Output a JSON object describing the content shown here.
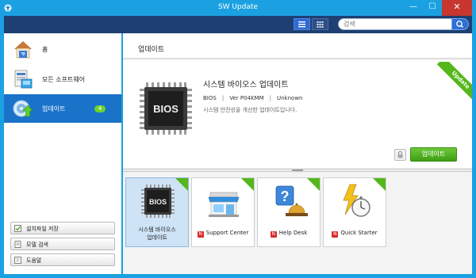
{
  "window": {
    "title": "SW Update",
    "close": "✕",
    "maximize": "☐",
    "minimize": "—"
  },
  "toolbar": {
    "search_placeholder": "검색"
  },
  "sidebar": {
    "items": [
      {
        "label": "홈",
        "icon": "house-icon"
      },
      {
        "label": "모든 소프트웨어",
        "icon": "software-icon"
      },
      {
        "label": "업데이트",
        "icon": "update-icon",
        "badge": "4",
        "selected": true
      }
    ],
    "buttons": [
      {
        "label": "설치파일 저장",
        "icon": "save-icon"
      },
      {
        "label": "모델 검색",
        "icon": "document-icon"
      },
      {
        "label": "도움말",
        "icon": "help-icon"
      }
    ]
  },
  "main": {
    "title": "업데이트",
    "detail": {
      "title": "시스템 바이오스 업데이트",
      "category": "BIOS",
      "version": "Ver P04KMM",
      "size": "Unknown",
      "description": "시스템 안전성을 개선한 업데이트입니다.",
      "ribbon": "Update",
      "update_button": "업데이트",
      "chip_text": "BIOS"
    },
    "tiles": [
      {
        "label_line1": "시스템 바이오스",
        "label_line2": "업데이트",
        "icon": "bios-chip-icon",
        "selected": true,
        "chip_text": "BIOS"
      },
      {
        "label": "Support Center",
        "icon": "store-icon",
        "n_badge": "N"
      },
      {
        "label": "Help Desk",
        "icon": "help-desk-icon",
        "n_badge": "N"
      },
      {
        "label": "Quick Starter",
        "icon": "stopwatch-icon",
        "n_badge": "N"
      }
    ]
  },
  "colors": {
    "titlebar": "#1ba1e2",
    "toolbar": "#1d3f72",
    "selected_nav": "#1a73c9",
    "accent_green": "#55b71c"
  }
}
